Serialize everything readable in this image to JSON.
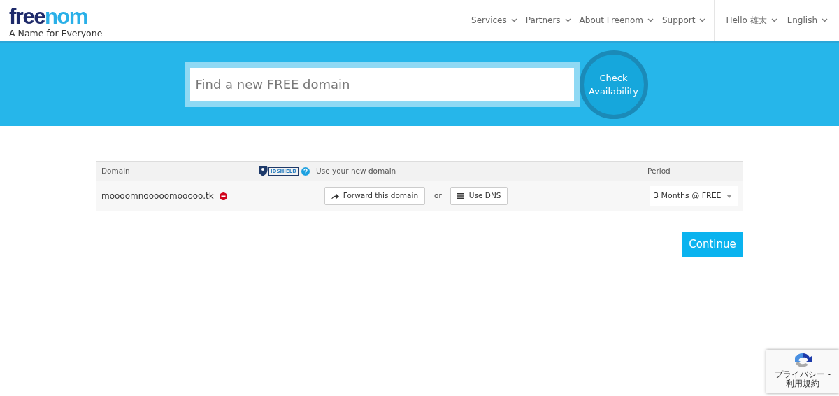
{
  "logo": {
    "part_1": "free",
    "part_2": "nom",
    "tagline": "A Name for Everyone"
  },
  "nav": {
    "items": [
      {
        "label": "Services"
      },
      {
        "label": "Partners"
      },
      {
        "label": "About Freenom"
      },
      {
        "label": "Support"
      }
    ],
    "account": [
      {
        "label": "Hello 雄太"
      },
      {
        "label": "English"
      }
    ]
  },
  "search": {
    "placeholder": "Find a new FREE domain",
    "button": [
      "Check",
      "Availability"
    ]
  },
  "table": {
    "columns": [
      "Domain",
      "Use your new domain",
      "Period"
    ],
    "idshield": "IDSHIELD",
    "rows": [
      {
        "domain": "moooomnooooomooooo.tk",
        "forward_button": "Forward this domain",
        "or": "or",
        "dns_button": "Use DNS",
        "period": "3 Months @ FREE"
      }
    ]
  },
  "continue_button": "Continue",
  "recaptcha": {
    "links": [
      "プライバシー -",
      "利用規約"
    ]
  }
}
